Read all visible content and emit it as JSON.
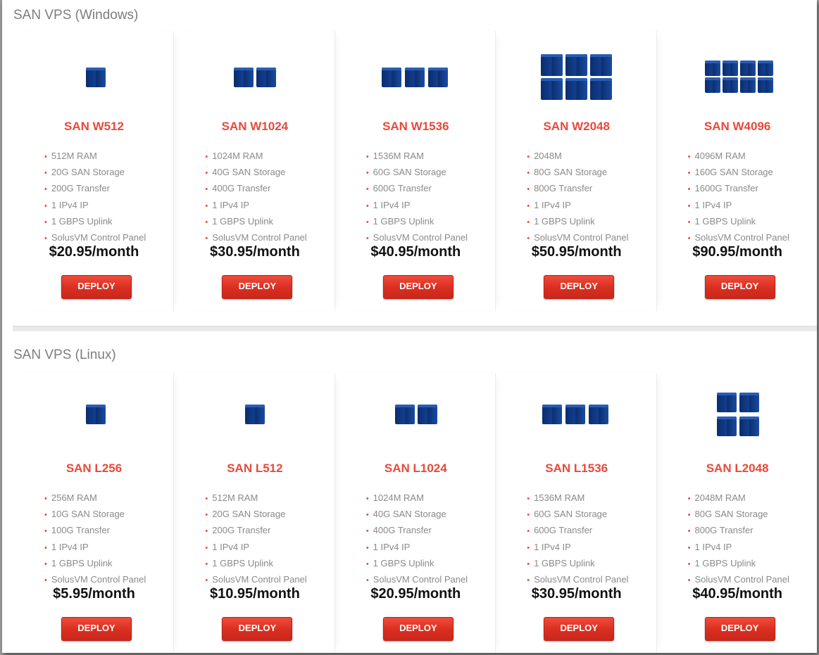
{
  "sections": [
    {
      "title": "SAN VPS (Windows)",
      "plans": [
        {
          "name": "SAN W512",
          "icon": "server-cube-1-icon",
          "features": [
            "512M RAM",
            "20G SAN Storage",
            "200G Transfer",
            "1 IPv4 IP",
            "1 GBPS Uplink",
            "SolusVM Control Panel"
          ],
          "price": "$20.95/month",
          "button": "DEPLOY"
        },
        {
          "name": "SAN W1024",
          "icon": "server-cubes-2-icon",
          "features": [
            "1024M RAM",
            "40G SAN Storage",
            "400G Transfer",
            "1 IPv4 IP",
            "1 GBPS Uplink",
            "SolusVM Control Panel"
          ],
          "price": "$30.95/month",
          "button": "DEPLOY"
        },
        {
          "name": "SAN W1536",
          "icon": "server-cubes-3-icon",
          "features": [
            "1536M RAM",
            "60G SAN Storage",
            "600G Transfer",
            "1 IPv4 IP",
            "1 GBPS Uplink",
            "SolusVM Control Panel"
          ],
          "price": "$40.95/month",
          "button": "DEPLOY"
        },
        {
          "name": "SAN W2048",
          "icon": "server-cubes-6-icon",
          "features": [
            "2048M",
            "80G SAN Storage",
            "800G Transfer",
            "1 IPv4 IP",
            "1 GBPS Uplink",
            "SolusVM Control Panel"
          ],
          "price": "$50.95/month",
          "button": "DEPLOY"
        },
        {
          "name": "SAN W4096",
          "icon": "server-cubes-8-icon",
          "features": [
            "4096M RAM",
            "160G SAN Storage",
            "1600G Transfer",
            "1 IPv4 IP",
            "1 GBPS Uplink",
            "SolusVM Control Panel"
          ],
          "price": "$90.95/month",
          "button": "DEPLOY"
        }
      ]
    },
    {
      "title": "SAN VPS (Linux)",
      "plans": [
        {
          "name": "SAN L256",
          "icon": "server-cube-1-icon",
          "features": [
            "256M RAM",
            "10G SAN Storage",
            "100G Transfer",
            "1 IPv4 IP",
            "1 GBPS Uplink",
            "SolusVM Control Panel"
          ],
          "price": "$5.95/month",
          "button": "DEPLOY"
        },
        {
          "name": "SAN L512",
          "icon": "server-cube-1-icon",
          "features": [
            "512M RAM",
            "20G SAN Storage",
            "200G Transfer",
            "1 IPv4 IP",
            "1 GBPS Uplink",
            "SolusVM Control Panel"
          ],
          "price": "$10.95/month",
          "button": "DEPLOY"
        },
        {
          "name": "SAN L1024",
          "icon": "server-cubes-2-icon",
          "features": [
            "1024M RAM",
            "40G SAN Storage",
            "400G Transfer",
            "1 IPv4 IP",
            "1 GBPS Uplink",
            "SolusVM Control Panel"
          ],
          "price": "$20.95/month",
          "button": "DEPLOY"
        },
        {
          "name": "SAN L1536",
          "icon": "server-cubes-3-icon",
          "features": [
            "1536M RAM",
            "60G SAN Storage",
            "600G Transfer",
            "1 IPv4 IP",
            "1 GBPS Uplink",
            "SolusVM Control Panel"
          ],
          "price": "$30.95/month",
          "button": "DEPLOY"
        },
        {
          "name": "SAN L2048",
          "icon": "server-cubes-4-icon",
          "features": [
            "2048M RAM",
            "80G SAN Storage",
            "800G Transfer",
            "1 IPv4 IP",
            "1 GBPS Uplink",
            "SolusVM Control Panel"
          ],
          "price": "$40.95/month",
          "button": "DEPLOY"
        }
      ]
    }
  ],
  "colors": {
    "accent": "#e8493a",
    "button": "#d92e20",
    "icon": "#133e8f",
    "price": "#111111",
    "feature_text": "#8a8a8a",
    "section_title": "#7d7d7d"
  }
}
